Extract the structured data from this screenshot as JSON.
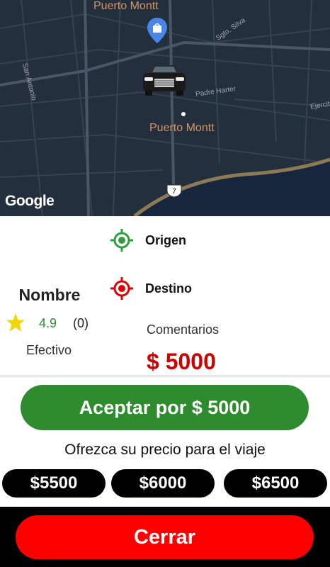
{
  "map": {
    "city_label_top": "Puerto Montt",
    "city_label_center": "Puerto Montt",
    "streets": [
      "Sgto. Silva",
      "Padre Harter",
      "San Antonio",
      "Ejercito"
    ],
    "route_number": "7",
    "attribution": "Google",
    "icons": [
      "shopping-pin-icon",
      "car-icon"
    ]
  },
  "trip": {
    "origin_label": "Origen",
    "destination_label": "Destino",
    "comments_label": "Comentarios",
    "price": "$ 5000"
  },
  "driver": {
    "name": "Nombre",
    "rating": "4.9",
    "rating_count": "(0)",
    "payment": "Efectivo"
  },
  "actions": {
    "accept_label": "Aceptar por $ 5000",
    "offer_prompt": "Ofrezca su precio para el viaje",
    "price_options": [
      "$5500",
      "$6000",
      "$6500"
    ],
    "close_label": "Cerrar"
  },
  "colors": {
    "accept": "#2e8b2e",
    "close": "#ff0000",
    "price": "#d10000",
    "origin_icon": "#2e9e3e",
    "destination_icon": "#e00000",
    "map_bg": "#242f3e"
  }
}
